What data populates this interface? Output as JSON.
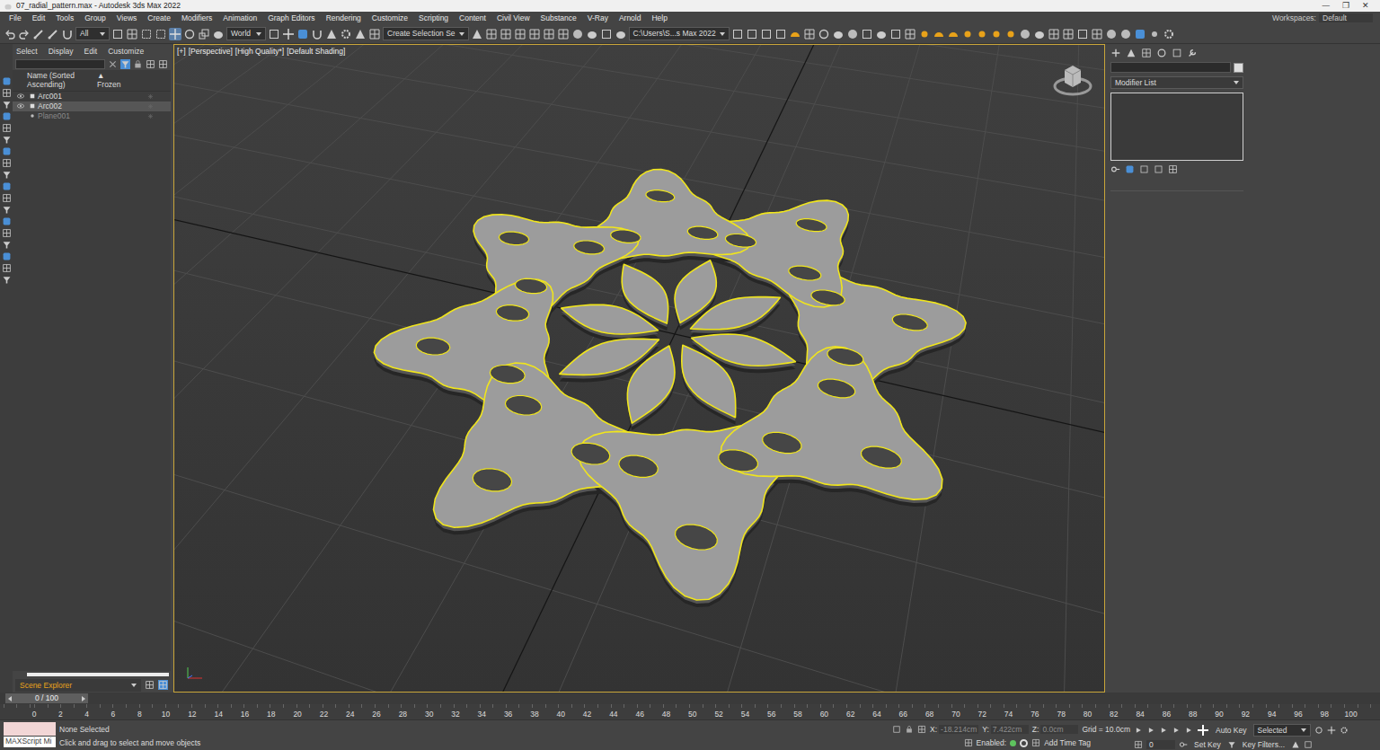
{
  "window": {
    "title": "07_radial_pattern.max - Autodesk 3ds Max 2022",
    "controls": [
      "—",
      "❐",
      "✕"
    ]
  },
  "menu": [
    "File",
    "Edit",
    "Tools",
    "Group",
    "Views",
    "Create",
    "Modifiers",
    "Animation",
    "Graph Editors",
    "Rendering",
    "Customize",
    "Scripting",
    "Content",
    "Civil View",
    "Substance",
    "V-Ray",
    "Arnold",
    "Help"
  ],
  "workspace": {
    "label": "Workspaces:",
    "value": "Default"
  },
  "toolbar": {
    "filter": "All",
    "coord_system": "World",
    "selection_set": "Create Selection Se",
    "project": "C:\\Users\\S...s Max 2022"
  },
  "explorer": {
    "tabs": [
      "Select",
      "Display",
      "Edit",
      "Customize"
    ],
    "columns": [
      "Name (Sorted Ascending)",
      "▲ Frozen"
    ],
    "items": [
      {
        "name": "Arc001",
        "hidden": false,
        "selected": false
      },
      {
        "name": "Arc002",
        "hidden": false,
        "selected": true
      },
      {
        "name": "Plane001",
        "hidden": true,
        "selected": false
      }
    ],
    "footer": "Scene Explorer"
  },
  "viewport": {
    "labels": [
      "[+]",
      "[Perspective]",
      "[High Quality*]",
      "[Default Shading]"
    ],
    "active": true
  },
  "command_panel": {
    "modifier_list": "Modifier List"
  },
  "timeline": {
    "position": "0 / 100",
    "level": 0,
    "ticks": [
      "0",
      "2",
      "4",
      "6",
      "8",
      "10",
      "12",
      "14",
      "16",
      "18",
      "20",
      "22",
      "24",
      "26",
      "28",
      "30",
      "32",
      "34",
      "36",
      "38",
      "40",
      "42",
      "44",
      "46",
      "48",
      "50",
      "52",
      "54",
      "56",
      "58",
      "60",
      "62",
      "64",
      "66",
      "68",
      "70",
      "72",
      "74",
      "76",
      "78",
      "80",
      "82",
      "84",
      "86",
      "88",
      "90",
      "92",
      "94",
      "96",
      "98",
      "100"
    ]
  },
  "status": {
    "maxscript": "MAXScript Mi",
    "selection": "None Selected",
    "prompt": "Click and drag to select and move objects",
    "coords": [
      {
        "axis": "X:",
        "value": "-18.214cm"
      },
      {
        "axis": "Y:",
        "value": "7.422cm"
      },
      {
        "axis": "Z:",
        "value": "0.0cm"
      }
    ],
    "grid": "Grid = 10.0cm",
    "enabled": "Enabled:",
    "add_time_tag": "Add Time Tag"
  },
  "animation": {
    "auto_key": "Auto Key",
    "key_mode": "Selected",
    "set_key": "Set Key",
    "key_filters": "Key Filters...",
    "frame": "0"
  }
}
